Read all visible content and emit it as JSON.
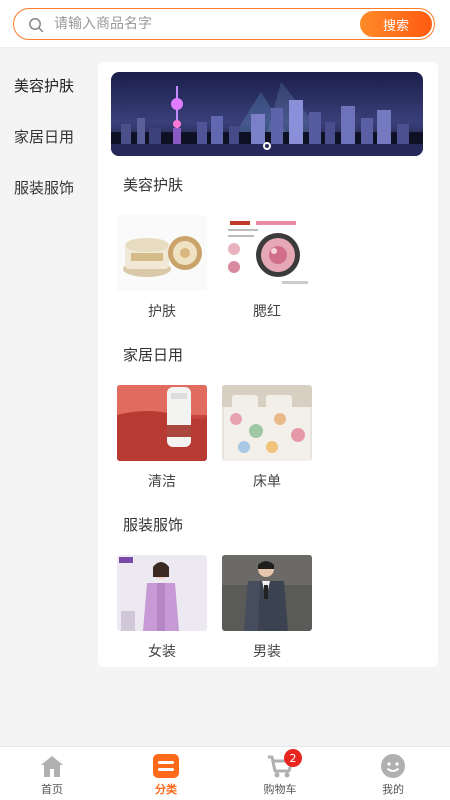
{
  "search": {
    "placeholder": "请输入商品名字",
    "button_label": "搜索"
  },
  "sidebar": {
    "items": [
      {
        "label": "美容护肤"
      },
      {
        "label": "家居日用"
      },
      {
        "label": "服装服饰"
      }
    ]
  },
  "sections": [
    {
      "title": "美容护肤",
      "products": [
        {
          "label": "护肤"
        },
        {
          "label": "腮红"
        }
      ]
    },
    {
      "title": "家居日用",
      "products": [
        {
          "label": "清洁"
        },
        {
          "label": "床单"
        }
      ]
    },
    {
      "title": "服装服饰",
      "products": [
        {
          "label": "女装"
        },
        {
          "label": "男装"
        }
      ]
    }
  ],
  "tabbar": {
    "items": [
      {
        "label": "首页",
        "icon": "home-icon"
      },
      {
        "label": "分类",
        "icon": "category-icon"
      },
      {
        "label": "购物车",
        "icon": "cart-icon",
        "badge": "2"
      },
      {
        "label": "我的",
        "icon": "profile-icon"
      }
    ],
    "active_index": 1
  },
  "colors": {
    "accent": "#ff6a1a",
    "badge": "#e8261f",
    "search_border": "#ff7a2a"
  }
}
